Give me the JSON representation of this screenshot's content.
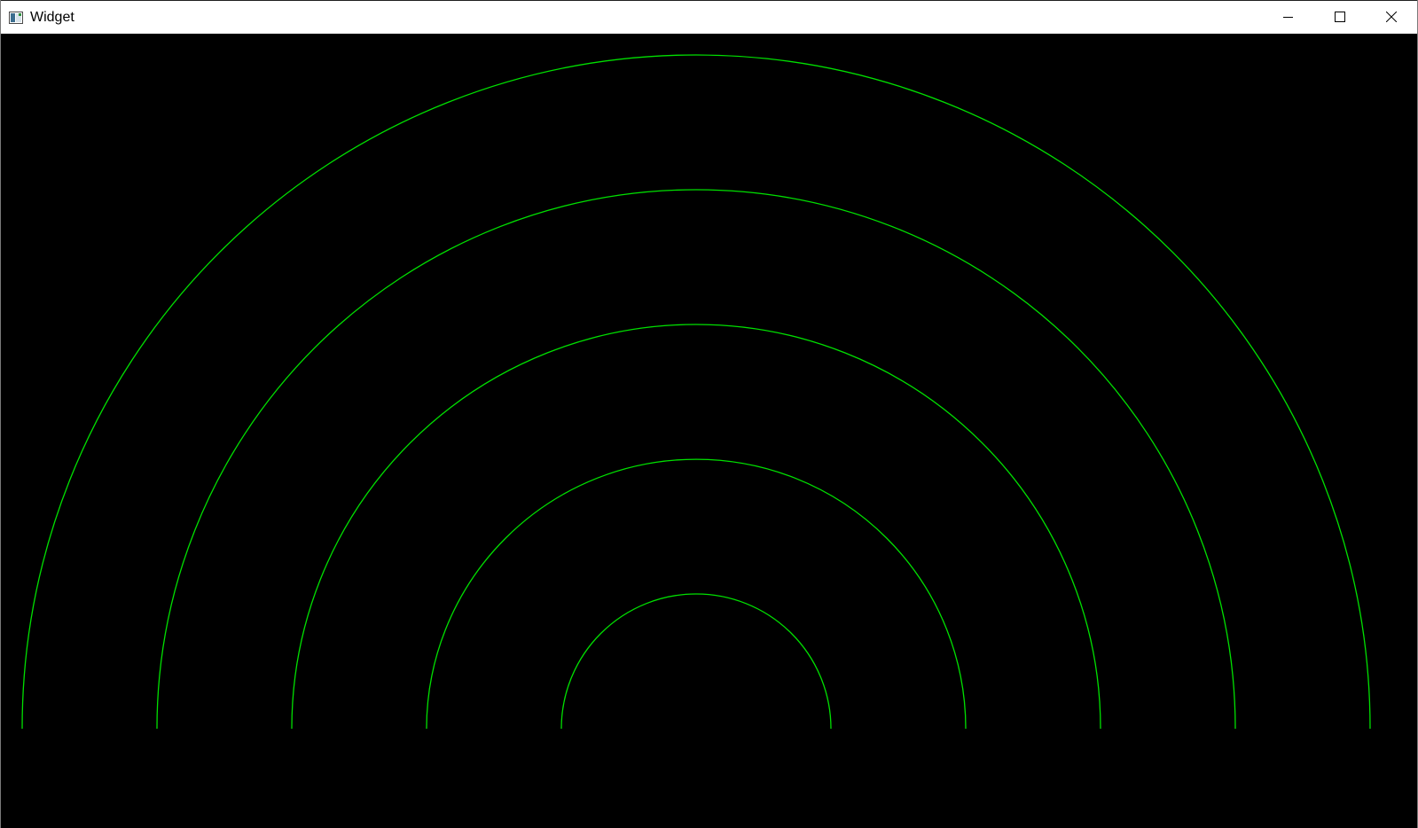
{
  "window": {
    "title": "Widget",
    "icon": "app-window-icon",
    "controls": [
      "minimize-icon",
      "maximize-icon",
      "close-icon"
    ]
  },
  "canvas": {
    "background": "#000000",
    "stroke_color": "#00e000",
    "arc_count": 5,
    "shape": "concentric-semicircles"
  }
}
